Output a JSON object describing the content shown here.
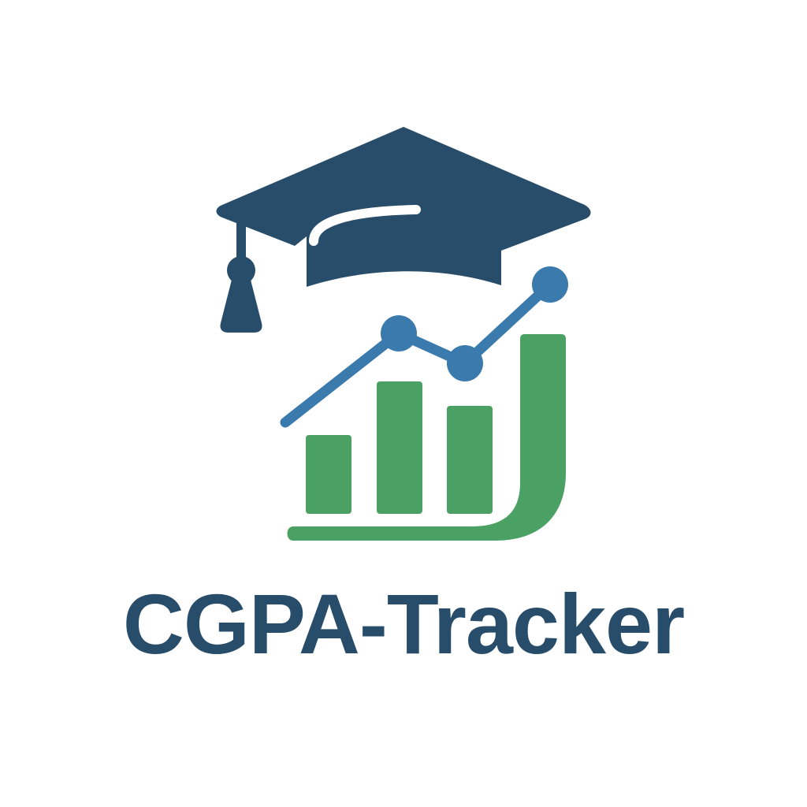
{
  "brand": {
    "name": "CGPA-Tracker"
  },
  "colors": {
    "navy": "#284D6A",
    "blue": "#3A7AAD",
    "green": "#4BA063",
    "background": "#FFFFFF"
  },
  "icons": {
    "cap": "graduation-cap-icon",
    "trend": "trend-line-icon",
    "bars": "bar-chart-icon"
  }
}
